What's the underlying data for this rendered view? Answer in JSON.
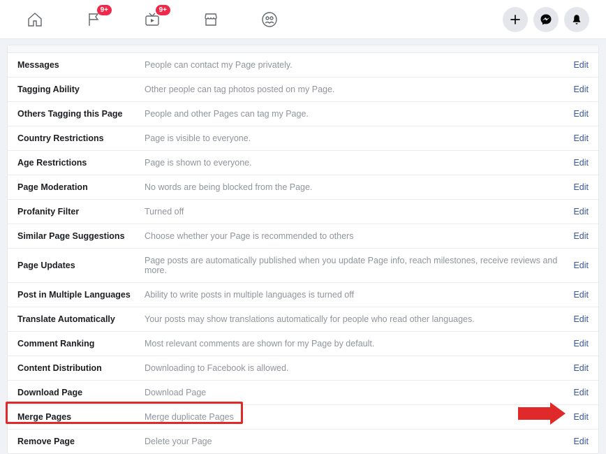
{
  "topbar": {
    "badge1": "9+",
    "badge2": "9+"
  },
  "edit_label": "Edit",
  "rows": [
    {
      "label": "Messages",
      "desc": "People can contact my Page privately."
    },
    {
      "label": "Tagging Ability",
      "desc": "Other people can tag photos posted on my Page."
    },
    {
      "label": "Others Tagging this Page",
      "desc": "People and other Pages can tag my Page."
    },
    {
      "label": "Country Restrictions",
      "desc": "Page is visible to everyone."
    },
    {
      "label": "Age Restrictions",
      "desc": "Page is shown to everyone."
    },
    {
      "label": "Page Moderation",
      "desc": "No words are being blocked from the Page."
    },
    {
      "label": "Profanity Filter",
      "desc": "Turned off"
    },
    {
      "label": "Similar Page Suggestions",
      "desc": "Choose whether your Page is recommended to others"
    },
    {
      "label": "Page Updates",
      "desc": "Page posts are automatically published when you update Page info, reach milestones, receive reviews and more."
    },
    {
      "label": "Post in Multiple Languages",
      "desc": "Ability to write posts in multiple languages is turned off"
    },
    {
      "label": "Translate Automatically",
      "desc": "Your posts may show translations automatically for people who read other languages."
    },
    {
      "label": "Comment Ranking",
      "desc": "Most relevant comments are shown for my Page by default."
    },
    {
      "label": "Content Distribution",
      "desc": "Downloading to Facebook is allowed."
    },
    {
      "label": "Download Page",
      "desc": "Download Page"
    },
    {
      "label": "Merge Pages",
      "desc": "Merge duplicate Pages"
    },
    {
      "label": "Remove Page",
      "desc": "Delete your Page"
    }
  ]
}
